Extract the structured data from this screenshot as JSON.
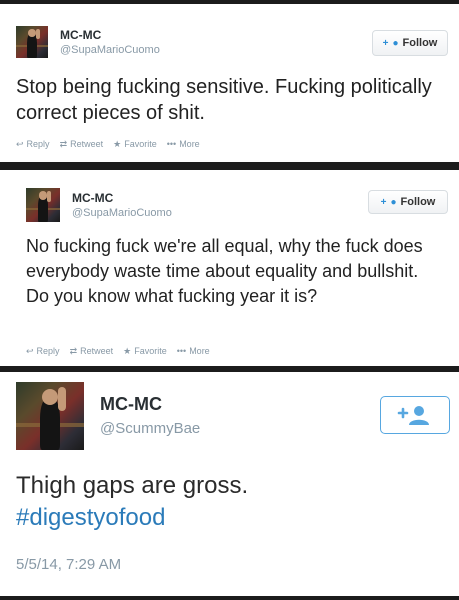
{
  "tweets": [
    {
      "name": "MC-MC",
      "handle": "@SupaMarioCuomo",
      "follow_label": "Follow",
      "follow_icon": "+",
      "text": "Stop being fucking sensitive. Fucking politically correct pieces of shit.",
      "actions": {
        "reply": "Reply",
        "retweet": "Retweet",
        "favorite": "Favorite",
        "more": "More"
      }
    },
    {
      "name": "MC-MC",
      "handle": "@SupaMarioCuomo",
      "follow_label": "Follow",
      "follow_icon": "+",
      "text": "No fucking fuck we're all equal, why the fuck does everybody waste time about equality and bullshit. Do you know what fucking year it is?",
      "actions": {
        "reply": "Reply",
        "retweet": "Retweet",
        "favorite": "Favorite",
        "more": "More"
      }
    },
    {
      "name": "MC-MC",
      "handle": "@ScummyBae",
      "text": "Thigh gaps are gross.",
      "hashtag": "#digestyofood",
      "date": "5/5/14, 7:29 AM"
    }
  ],
  "colors": {
    "accent": "#2b7bb9",
    "muted": "#8899a6",
    "text": "#222222"
  }
}
